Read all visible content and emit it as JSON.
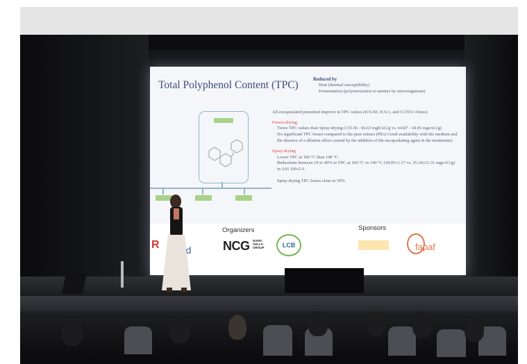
{
  "slide": {
    "title": "Total Polyphenol Content (TPC)",
    "reduced_by": {
      "heading": "Reduced by",
      "items": [
        "Heat (thermal susceptibility)",
        "Fermentation (polymerization to tannins by microorganism)"
      ]
    },
    "intro": "All encapsulated presented improve in TPC values (ICS-60, ICS-1, and CCN51 clones)",
    "freeze": {
      "heading": "Freeze-drying",
      "items": [
        "Twice TPC values than Spray-drying (135.56 - 66.63 mgEAG/g vs. 64.87 - 18.05 mgeAG/g)",
        "No significant TPC losses compared to the pure extract (PEx) Good availability with the medium and the absence of a dilution effect caused by the addition of the encapsulating agent in the treatments)"
      ]
    },
    "spray": {
      "heading": "Spray-drying",
      "items": [
        "Lower TPC at 160 °C than 140 °C",
        "Reductions between 19 to 49% in TPC at 160 °C vs 140 °C (18.05±1.17 vs. 35.24±11.31 mgeAG/g) in A16 160-GA"
      ],
      "note": "Spray drying TPC losses close to 50%"
    },
    "organizers_label": "Organizers",
    "sponsors_label": "Sponsors",
    "logos": [
      "NCG",
      "NANO CELLS GROUP",
      "LCB",
      "fapaf"
    ],
    "logo_fragments": [
      "R",
      "ned"
    ]
  },
  "colors": {
    "slide_title": "#3b4c7a",
    "slide_heading_red": "#d9453e",
    "diagram_green": "#a7d28a",
    "diagram_blue": "#8fb5c8"
  }
}
